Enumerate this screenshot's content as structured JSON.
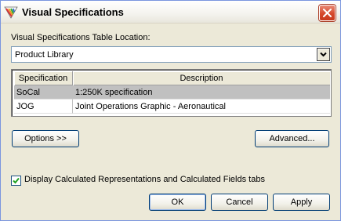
{
  "window": {
    "title": "Visual Specifications",
    "app_icon": "pencil-ruler-icon",
    "close_icon": "close-icon"
  },
  "location": {
    "label": "Visual Specifications Table Location:",
    "selected": "Product Library",
    "dropdown_icon": "chevron-down-icon"
  },
  "table": {
    "columns": [
      "Specification",
      "Description"
    ],
    "rows": [
      {
        "specification": "SoCal",
        "description": "1:250K specification",
        "selected": true
      },
      {
        "specification": "JOG",
        "description": "Joint Operations Graphic - Aeronautical",
        "selected": false
      }
    ]
  },
  "buttons": {
    "options": "Options >>",
    "advanced": "Advanced...",
    "ok": "OK",
    "cancel": "Cancel",
    "apply": "Apply"
  },
  "checkbox": {
    "label": "Display Calculated Representations and Calculated Fields tabs",
    "checked": true
  },
  "colors": {
    "dialog_bg": "#ece9d8",
    "selection": "#c0c0c0",
    "close_red": "#d5492c",
    "check_green": "#21a121"
  }
}
